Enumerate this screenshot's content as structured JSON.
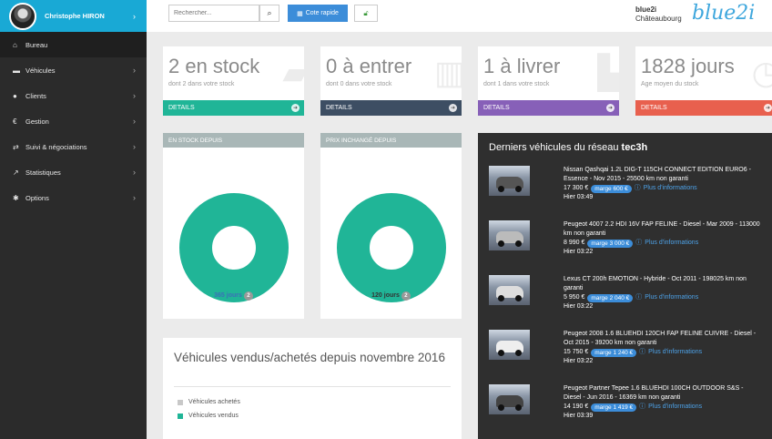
{
  "user": {
    "name": "Christophe HIRON"
  },
  "nav": [
    {
      "icon": "home-icon",
      "glyph": "⌂",
      "label": "Bureau",
      "chevron": false
    },
    {
      "icon": "car-icon",
      "glyph": "▬",
      "label": "Véhicules",
      "chevron": true
    },
    {
      "icon": "user-icon",
      "glyph": "●",
      "label": "Clients",
      "chevron": true
    },
    {
      "icon": "euro-icon",
      "glyph": "€",
      "label": "Gestion",
      "chevron": true
    },
    {
      "icon": "exchange-icon",
      "glyph": "⇄",
      "label": "Suivi & négociations",
      "chevron": true
    },
    {
      "icon": "chart-icon",
      "glyph": "↗",
      "label": "Statistiques",
      "chevron": true
    },
    {
      "icon": "gear-icon",
      "glyph": "✱",
      "label": "Options",
      "chevron": true
    }
  ],
  "topbar": {
    "search_placeholder": "Rechercher...",
    "quote_label": "Cote rapide",
    "site_name": "blue2i",
    "site_city": "Châteaubourg",
    "brand": "blue2i"
  },
  "stats": [
    {
      "big": "2 en stock",
      "sub": "dont 2 dans votre stock",
      "foot": "DETAILS",
      "color": "#20b597"
    },
    {
      "big": "0 à entrer",
      "sub": "dont 0 dans votre stock",
      "foot": "DETAILS",
      "color": "#3d4e63"
    },
    {
      "big": "1 à livrer",
      "sub": "dont 1 dans votre stock",
      "foot": "DETAILS",
      "color": "#8760b8"
    },
    {
      "big": "1828 jours",
      "sub": "Age moyen du stock",
      "foot": "DETAILS",
      "color": "#e8604e"
    }
  ],
  "donuts": [
    {
      "header": "EN STOCK DEPUIS",
      "label": "365 jours",
      "badge": "2",
      "label_color": "#3c6fb8"
    },
    {
      "header": "PRIX INCHANGÉ DEPUIS",
      "label": "120 jours",
      "badge": "2",
      "label_color": "#333333"
    }
  ],
  "sold": {
    "title": "Véhicules vendus/achetés depuis novembre 2016",
    "legend": [
      {
        "label": "Véhicules achetés",
        "color": "#c8c8c8"
      },
      {
        "label": "Véhicules vendus",
        "color": "#20b597"
      }
    ]
  },
  "network": {
    "title_prefix": "Derniers véhicules du réseau",
    "title_bold": "tec3h",
    "cars": [
      {
        "desc": "Nissan Qashqai 1.2L DIG-T 115CH CONNECT EDITION EURO6 - Essence - Nov 2015 - 25500 km non garanti",
        "price": "17 300 €",
        "marge": "marge 600 €",
        "plus": "Plus d'informations",
        "time": "Hier 03:49"
      },
      {
        "desc": "Peugeot 4007 2.2 HDI 16V FAP FELINE - Diesel - Mar 2009 - 113000 km non garanti",
        "price": "8 990 €",
        "marge": "marge 3 000 €",
        "plus": "Plus d'informations",
        "time": "Hier 03:22"
      },
      {
        "desc": "Lexus CT 200h EMOTION - Hybride - Oct 2011 - 198025 km non garanti",
        "price": "5 950 €",
        "marge": "marge 2 040 €",
        "plus": "Plus d'informations",
        "time": "Hier 03:22"
      },
      {
        "desc": "Peugeot 2008 1.6 BLUEHDI 120CH FAP FELINE CUIVRE - Diesel - Oct 2015 - 39200 km non garanti",
        "price": "15 750 €",
        "marge": "marge 1 240 €",
        "plus": "Plus d'informations",
        "time": "Hier 03:22"
      },
      {
        "desc": "Peugeot Partner Tepee 1.6 BLUEHDI 100CH OUTDOOR S&S - Diesel - Jun 2016 - 16369 km non garanti",
        "price": "14 190 €",
        "marge": "marge 1 419 €",
        "plus": "Plus d'informations",
        "time": "Hier 03:39"
      }
    ]
  },
  "colors": {
    "accent": "#19a9d5",
    "donut": "#20b597",
    "sidebar": "#2b2b2b"
  }
}
